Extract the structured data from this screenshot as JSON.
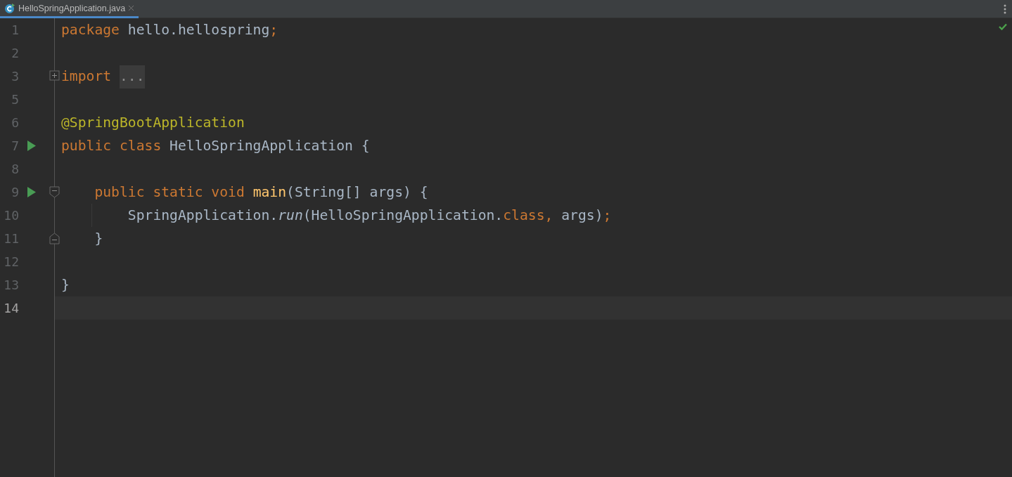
{
  "tabs": [
    {
      "label": "HelloSpringApplication.java",
      "selected": true
    }
  ],
  "lines": [
    {
      "number": "1",
      "current": false,
      "tokens": [
        {
          "kind": "keyword",
          "text": "package "
        },
        {
          "kind": "plain",
          "text": "hello.hellospring"
        },
        {
          "kind": "keyword",
          "text": ";"
        }
      ]
    },
    {
      "number": "2",
      "current": false
    },
    {
      "number": "3",
      "current": false,
      "gutter_icons": [
        {
          "kind": "fold-collapsed"
        }
      ],
      "tokens": [
        {
          "kind": "keyword",
          "text": "import "
        },
        {
          "kind": "folded",
          "text": "..."
        }
      ]
    },
    {
      "number": "5",
      "current": false
    },
    {
      "number": "6",
      "current": false,
      "tokens": [
        {
          "kind": "annotation",
          "text": "@SpringBootApplication"
        }
      ]
    },
    {
      "number": "7",
      "current": false,
      "gutter_icons": [
        {
          "kind": "run"
        }
      ],
      "tokens": [
        {
          "kind": "keyword",
          "text": "public class "
        },
        {
          "kind": "plain",
          "text": "HelloSpringApplication {"
        }
      ]
    },
    {
      "number": "8",
      "current": false
    },
    {
      "number": "9",
      "current": false,
      "gutter_icons": [
        {
          "kind": "run"
        },
        {
          "kind": "fold-start"
        }
      ],
      "tokens": [
        {
          "kind": "keyword",
          "text": "    public static void "
        },
        {
          "kind": "method",
          "text": "main"
        },
        {
          "kind": "plain",
          "text": "(String[] args) {"
        }
      ]
    },
    {
      "number": "10",
      "current": false,
      "indent_guide": true,
      "tokens": [
        {
          "kind": "plain",
          "text": "        SpringApplication."
        },
        {
          "kind": "italic",
          "text": "run"
        },
        {
          "kind": "plain",
          "text": "(HelloSpringApplication."
        },
        {
          "kind": "keyword",
          "text": "class, "
        },
        {
          "kind": "plain",
          "text": "args)"
        },
        {
          "kind": "keyword",
          "text": ";"
        }
      ]
    },
    {
      "number": "11",
      "current": false,
      "gutter_icons": [
        {
          "kind": "fold-end"
        }
      ],
      "tokens": [
        {
          "kind": "plain",
          "text": "    }"
        }
      ]
    },
    {
      "number": "12",
      "current": false
    },
    {
      "number": "13",
      "current": false,
      "tokens": [
        {
          "kind": "plain",
          "text": "}"
        }
      ]
    },
    {
      "number": "14",
      "current": true
    }
  ]
}
